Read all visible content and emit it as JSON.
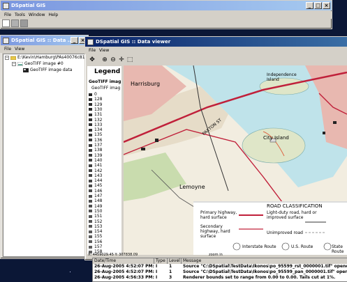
{
  "main_window": {
    "title": "DSpatial GIS",
    "menu": [
      "File",
      "Tools",
      "Window",
      "Help"
    ]
  },
  "data_window": {
    "title": "DSpatial GIS :: Data ...",
    "menu": [
      "File",
      "View"
    ],
    "tree": {
      "root": "E:\\Kevin\\Hamburg\\PAs40076c81",
      "child": "GeoTIFF image #0",
      "leaf": "GeoTIFF image data"
    }
  },
  "viewer_window": {
    "title": "DSpatial GIS :: Data viewer",
    "menu": [
      "File",
      "View"
    ],
    "tools": [
      "pan-icon",
      "zoom-in-icon",
      "zoom-out-icon",
      "move-icon",
      "zoom-box-icon"
    ],
    "legend": {
      "title": "Legend",
      "group": "GeoTIFF imag",
      "subgroup": "GeoTIFF imag",
      "items": [
        "0",
        "128",
        "129",
        "130",
        "131",
        "132",
        "133",
        "134",
        "135",
        "136",
        "137",
        "138",
        "139",
        "140",
        "141",
        "142",
        "143",
        "144",
        "145",
        "146",
        "147",
        "148",
        "149",
        "150",
        "151",
        "152",
        "153",
        "154",
        "155",
        "156",
        "157",
        "158",
        "159"
      ]
    },
    "status": {
      "coords": "X: 4459029.45 Y: 307838.09",
      "zoom": "zoom in"
    },
    "map_text": {
      "place1": "Lemoyne",
      "place2": "Independence Island",
      "place3": "City Island",
      "place4": "Harrisburg",
      "street": "PAXTON ST",
      "road_class_title": "ROAD CLASSIFICATION",
      "primary": "Primary highway, hard surface",
      "light": "Light-duty road, hard or improved surface",
      "secondary": "Secondary highway, hard surface",
      "unimproved": "Unimproved road",
      "interstate": "Interstate Route",
      "us": "U.S. Route",
      "state": "State Route"
    }
  },
  "log": {
    "columns": [
      "Date/Time",
      "Type",
      "Level",
      "Message"
    ],
    "rows": [
      [
        "26-Aug-2005 4:52:07 PM:14",
        "I",
        "1",
        "Source \"C:\\DSpatial\\TestData\\Ikonos\\po_95599_rst_0000001.tif\" opened."
      ],
      [
        "26-Aug-2005 4:52:07 PM:14",
        "I",
        "1",
        "Source \"C:\\DSpatial\\TestData\\Ikonos\\po_95599_pan_0000001.tif\" opened."
      ],
      [
        "26-Aug-2005 4:56:33 PM:95",
        "I",
        "3",
        "Renderer bounds set to range from 0.00 to 0.00. Tails cut at 1%."
      ]
    ]
  }
}
